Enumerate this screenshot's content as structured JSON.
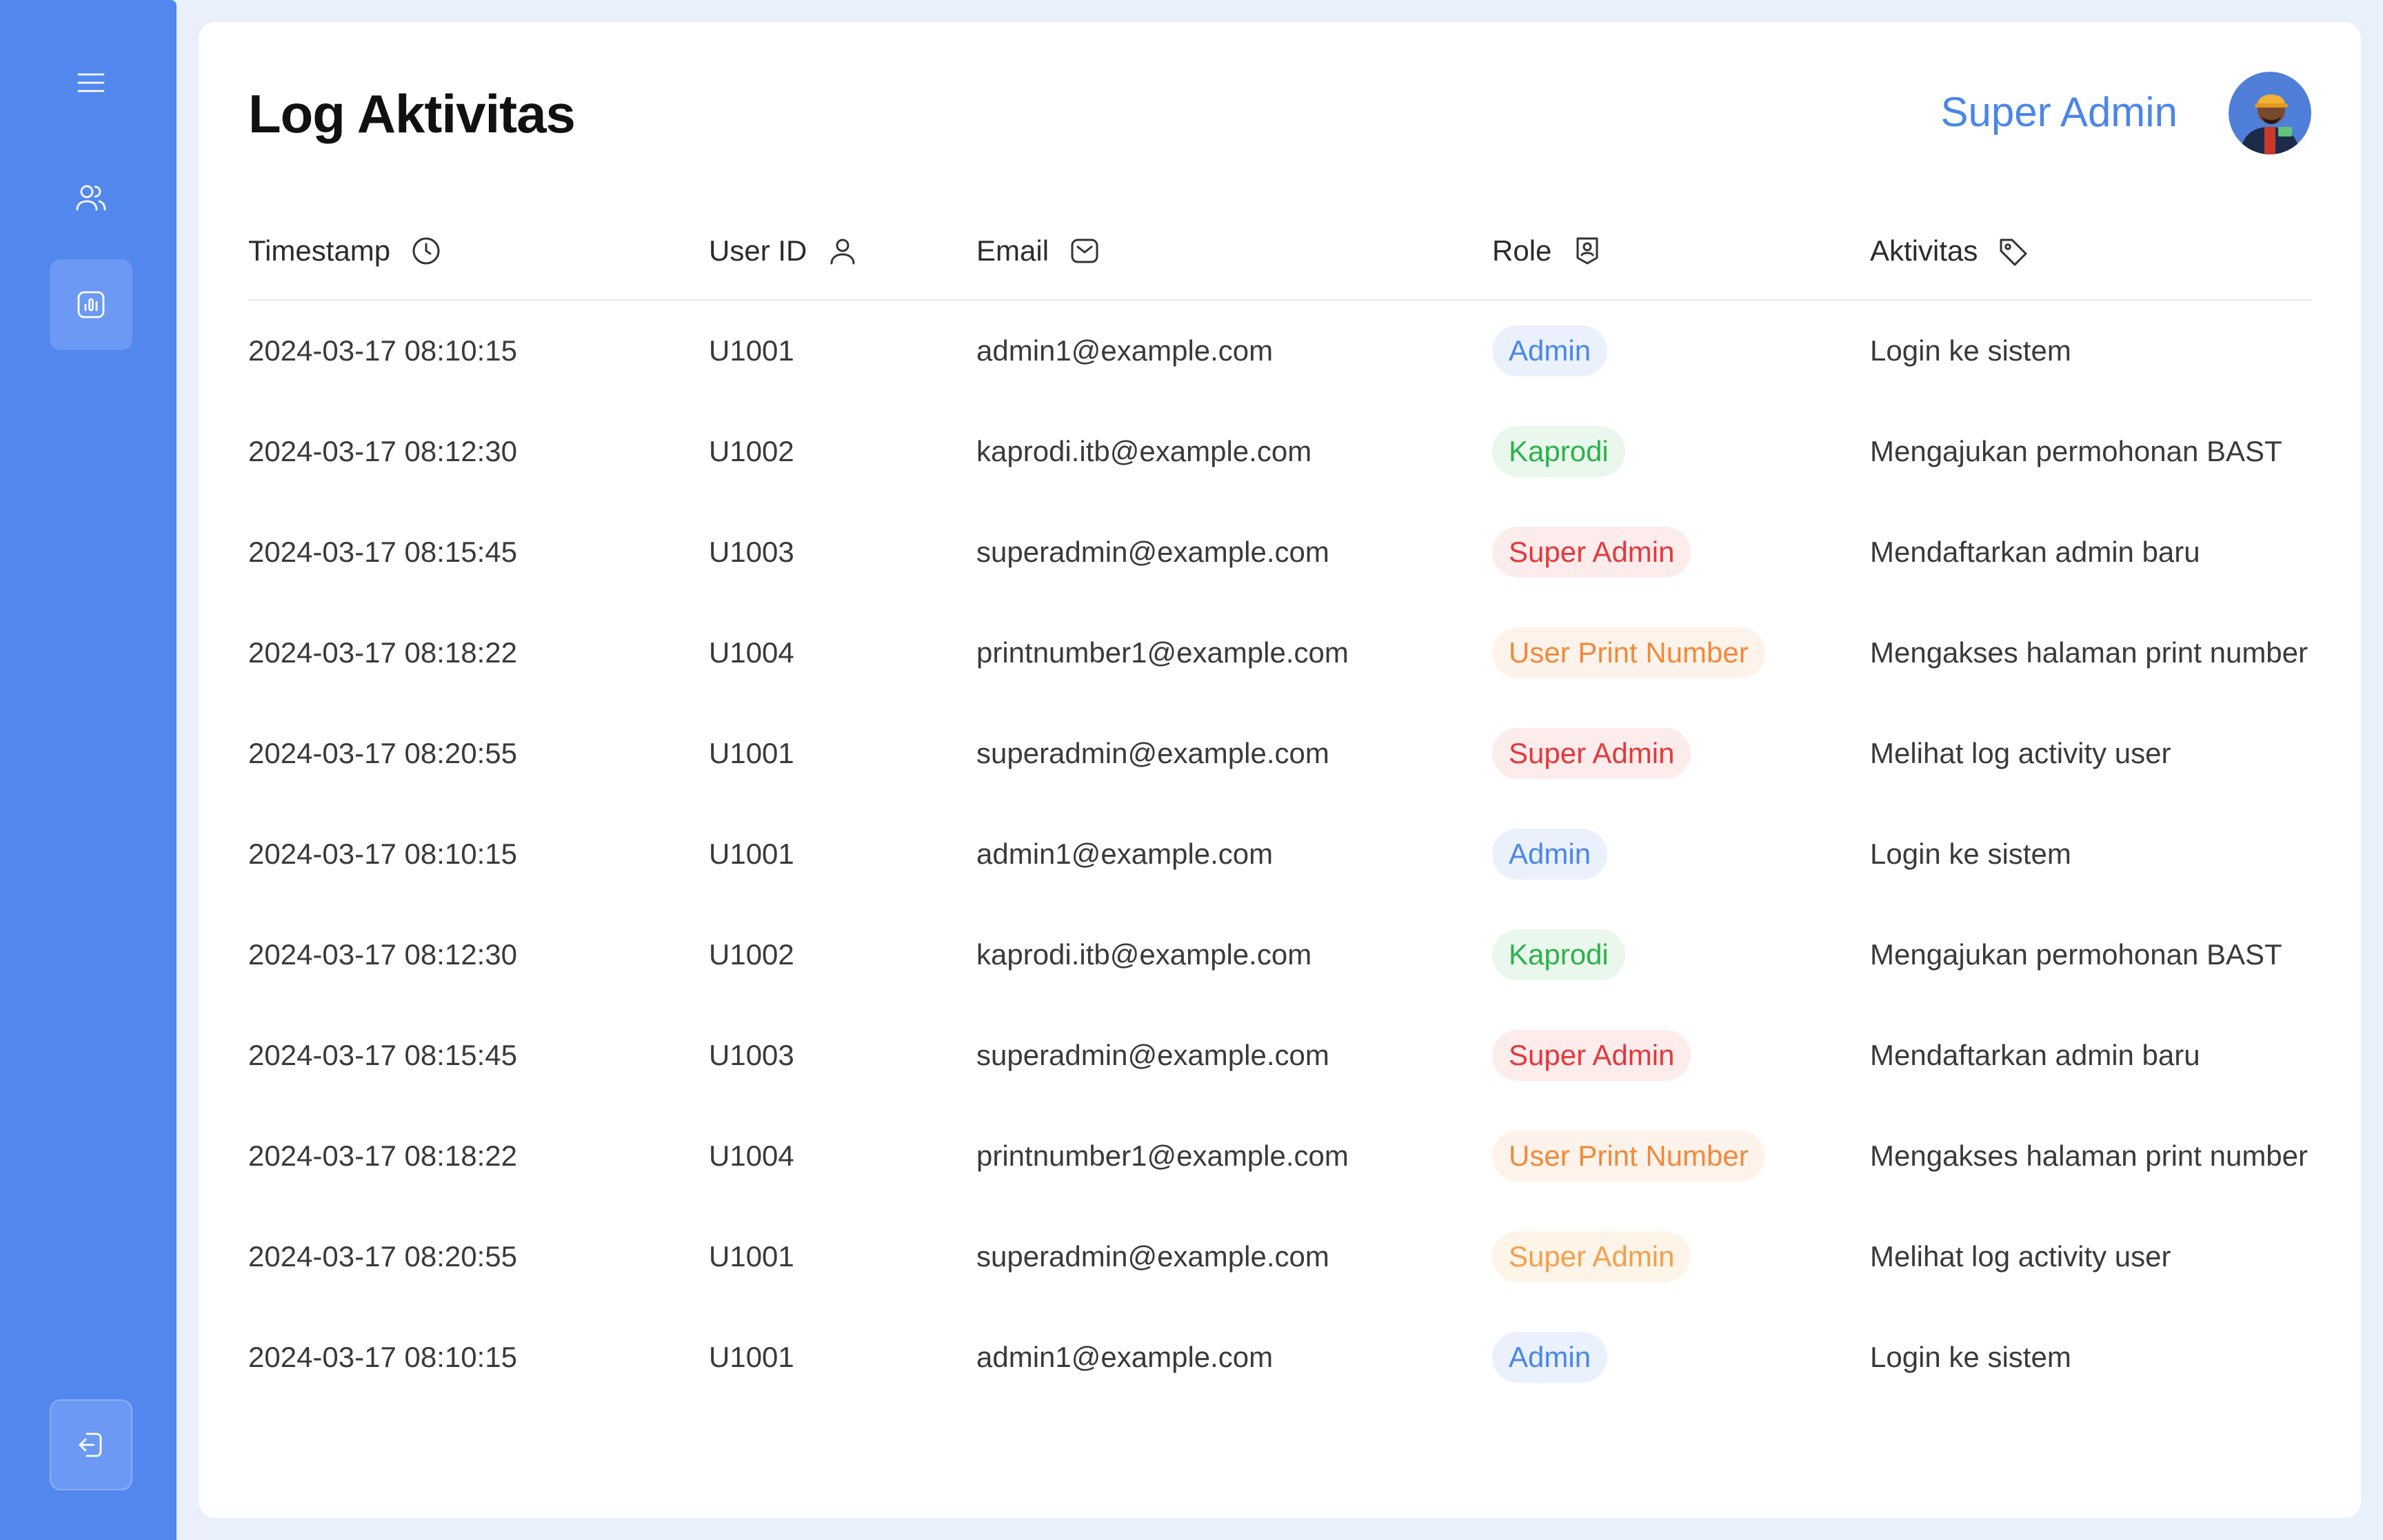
{
  "app": {
    "page_title": "Log Aktivitas",
    "user_name": "Super Admin"
  },
  "sidebar": {
    "items": [
      {
        "icon": "menu-icon"
      },
      {
        "icon": "users-icon"
      },
      {
        "icon": "chart-icon",
        "active": true
      },
      {
        "icon": "logout-icon"
      }
    ]
  },
  "table": {
    "columns": [
      {
        "label": "Timestamp",
        "icon": "clock-icon"
      },
      {
        "label": "User ID",
        "icon": "user-icon"
      },
      {
        "label": "Email",
        "icon": "mail-icon"
      },
      {
        "label": "Role",
        "icon": "badge-icon"
      },
      {
        "label": "Aktivitas",
        "icon": "tag-icon"
      }
    ],
    "rows": [
      {
        "timestamp": "2024-03-17 08:10:15",
        "user_id": "U1001",
        "email": "admin1@example.com",
        "role": "Admin",
        "role_color": "#4a86ea",
        "role_bg": "#eaf1fd",
        "activity": "Login ke sistem"
      },
      {
        "timestamp": "2024-03-17 08:12:30",
        "user_id": "U1002",
        "email": "kaprodi.itb@example.com",
        "role": "Kaprodi",
        "role_color": "#2bb24c",
        "role_bg": "#eaf7ec",
        "activity": "Mengajukan permohonan BAST"
      },
      {
        "timestamp": "2024-03-17 08:15:45",
        "user_id": "U1003",
        "email": "superadmin@example.com",
        "role": "Super Admin",
        "role_color": "#e5383b",
        "role_bg": "#fdecec",
        "activity": "Mendaftarkan admin baru"
      },
      {
        "timestamp": "2024-03-17 08:18:22",
        "user_id": "U1004",
        "email": "printnumber1@example.com",
        "role": "User Print Number",
        "role_color": "#f08a3c",
        "role_bg": "#fef3ea",
        "activity": "Mengakses halaman print number"
      },
      {
        "timestamp": "2024-03-17 08:20:55",
        "user_id": "U1001",
        "email": "superadmin@example.com",
        "role": "Super Admin",
        "role_color": "#e5383b",
        "role_bg": "#fdecec",
        "activity": "Melihat log activity user"
      },
      {
        "timestamp": "2024-03-17 08:10:15",
        "user_id": "U1001",
        "email": "admin1@example.com",
        "role": "Admin",
        "role_color": "#4a86ea",
        "role_bg": "#eaf1fd",
        "activity": "Login ke sistem"
      },
      {
        "timestamp": "2024-03-17 08:12:30",
        "user_id": "U1002",
        "email": "kaprodi.itb@example.com",
        "role": "Kaprodi",
        "role_color": "#2bb24c",
        "role_bg": "#eaf7ec",
        "activity": "Mengajukan permohonan BAST"
      },
      {
        "timestamp": "2024-03-17 08:15:45",
        "user_id": "U1003",
        "email": "superadmin@example.com",
        "role": "Super Admin",
        "role_color": "#e5383b",
        "role_bg": "#fdecec",
        "activity": "Mendaftarkan admin baru"
      },
      {
        "timestamp": "2024-03-17 08:18:22",
        "user_id": "U1004",
        "email": "printnumber1@example.com",
        "role": "User Print Number",
        "role_color": "#f08a3c",
        "role_bg": "#fef3ea",
        "activity": "Mengakses halaman print number"
      },
      {
        "timestamp": "2024-03-17 08:20:55",
        "user_id": "U1001",
        "email": "superadmin@example.com",
        "role": "Super Admin",
        "role_color": "#f2a04d",
        "role_bg": "#fef4e8",
        "activity": "Melihat log activity user"
      },
      {
        "timestamp": "2024-03-17 08:10:15",
        "user_id": "U1001",
        "email": "admin1@example.com",
        "role": "Admin",
        "role_color": "#4a86ea",
        "role_bg": "#eaf1fd",
        "activity": "Login ke sistem"
      }
    ]
  },
  "colors": {
    "sidebar": "#5287ee",
    "accent": "#4a86ea"
  }
}
